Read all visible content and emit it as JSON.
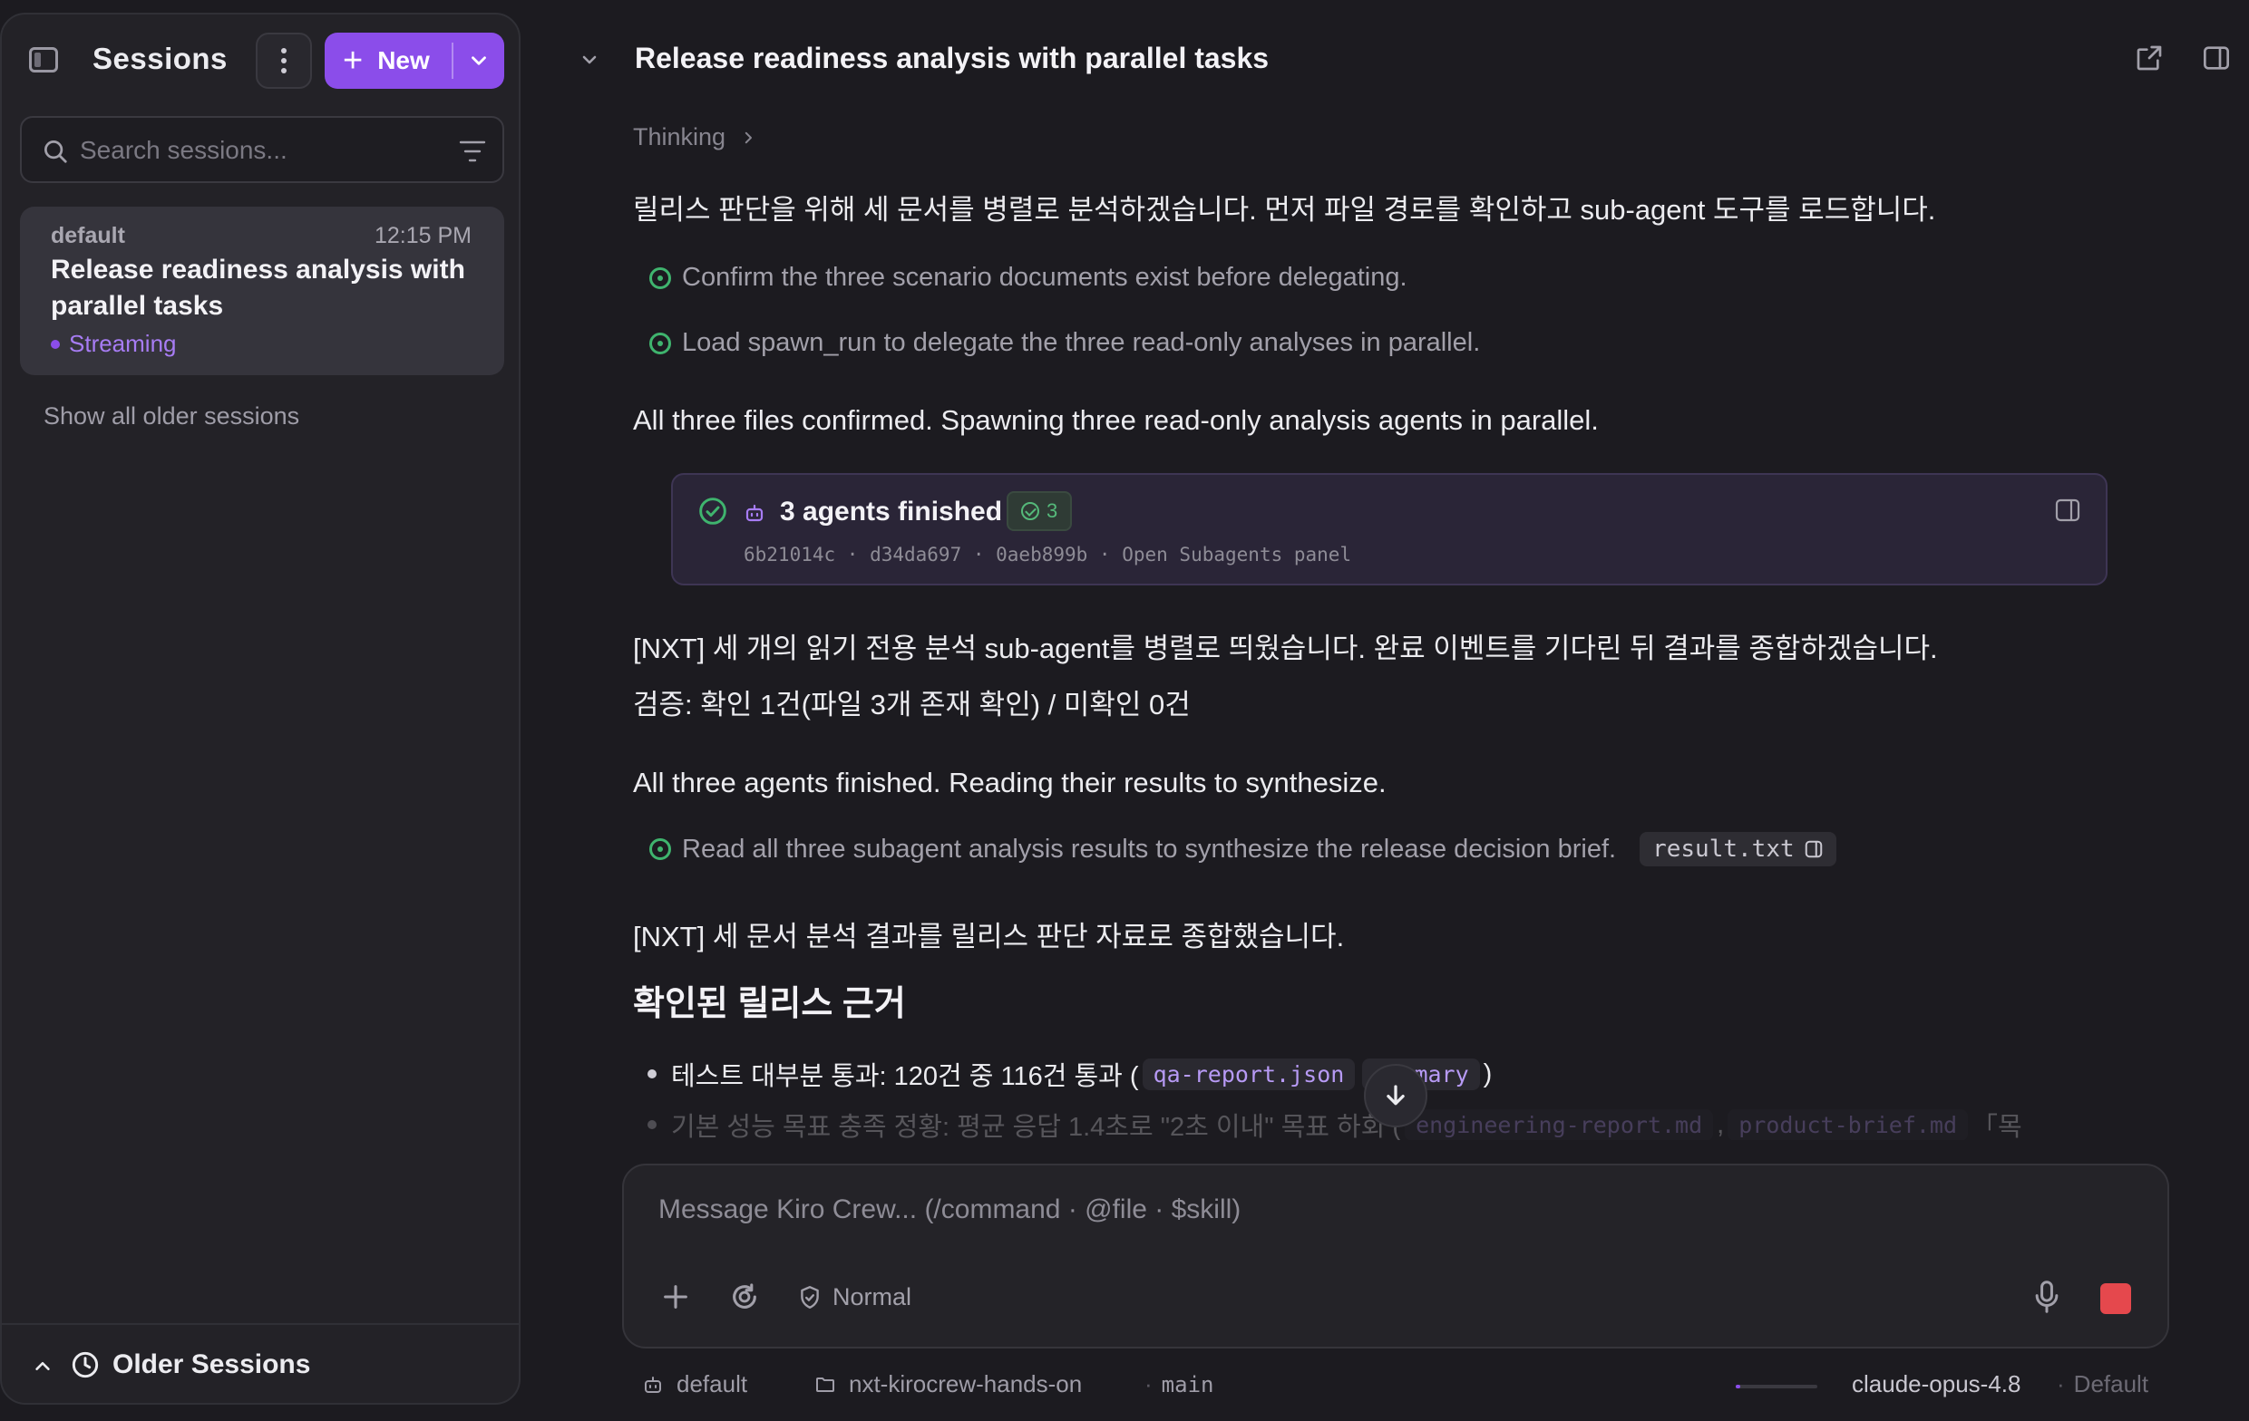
{
  "sidebar": {
    "title": "Sessions",
    "new_label": "New",
    "search_placeholder": "Search sessions...",
    "session": {
      "group": "default",
      "time": "12:15 PM",
      "title": "Release readiness analysis with parallel tasks",
      "status": "Streaming"
    },
    "older_link": "Show all older sessions",
    "footer_label": "Older Sessions"
  },
  "header": {
    "title": "Release readiness analysis with parallel tasks"
  },
  "thread": {
    "thinking_label": "Thinking",
    "p1": "릴리스 판단을 위해 세 문서를 병렬로 분석하겠습니다. 먼저 파일 경로를 확인하고 sub-agent 도구를 로드합니다.",
    "step1": "Confirm the three scenario documents exist before delegating.",
    "step2": "Load spawn_run to delegate the three read-only analyses in parallel.",
    "p2": "All three files confirmed. Spawning three read-only analysis agents in parallel.",
    "agents": {
      "title": "3 agents finished",
      "badge_count": "3",
      "ids": "6b21014c · d34da697 · 0aeb899b · Open Subagents panel"
    },
    "p3": "[NXT] 세 개의 읽기 전용 분석 sub-agent를 병렬로 띄웠습니다. 완료 이벤트를 기다린 뒤 결과를 종합하겠습니다.",
    "p4": "검증: 확인 1건(파일 3개 존재 확인) / 미확인 0건",
    "p5": "All three agents finished. Reading their results to synthesize.",
    "step3": "Read all three subagent analysis results to synthesize the release decision brief.",
    "step3_file": "result.txt",
    "p6": "[NXT] 세 문서 분석 결과를 릴리스 판단 자료로 종합했습니다.",
    "section_title": "확인된 릴리스 근거",
    "bullet1_text": "테스트 대부분 통과: 120건 중 116건 통과 (",
    "bullet1_code1": "qa-report.json",
    "bullet1_code2": "summary",
    "bullet1_end": ")",
    "bullet2_text": "기본 성능 목표 충족 정황: 평균 응답 1.4초로 \"2초 이내\" 목표 하회 (",
    "bullet2_code1": "engineering-report.md",
    "bullet2_code2": "product-brief.md",
    "bullet2_end": "「목"
  },
  "composer": {
    "placeholder": "Message Kiro Crew... (/command · @file · $skill)",
    "mode": "Normal"
  },
  "status": {
    "agent": "default",
    "folder": "nxt-kirocrew-hands-on",
    "branch": "main",
    "model": "claude-opus-4.8",
    "profile": "Default",
    "progress": 0.06
  }
}
